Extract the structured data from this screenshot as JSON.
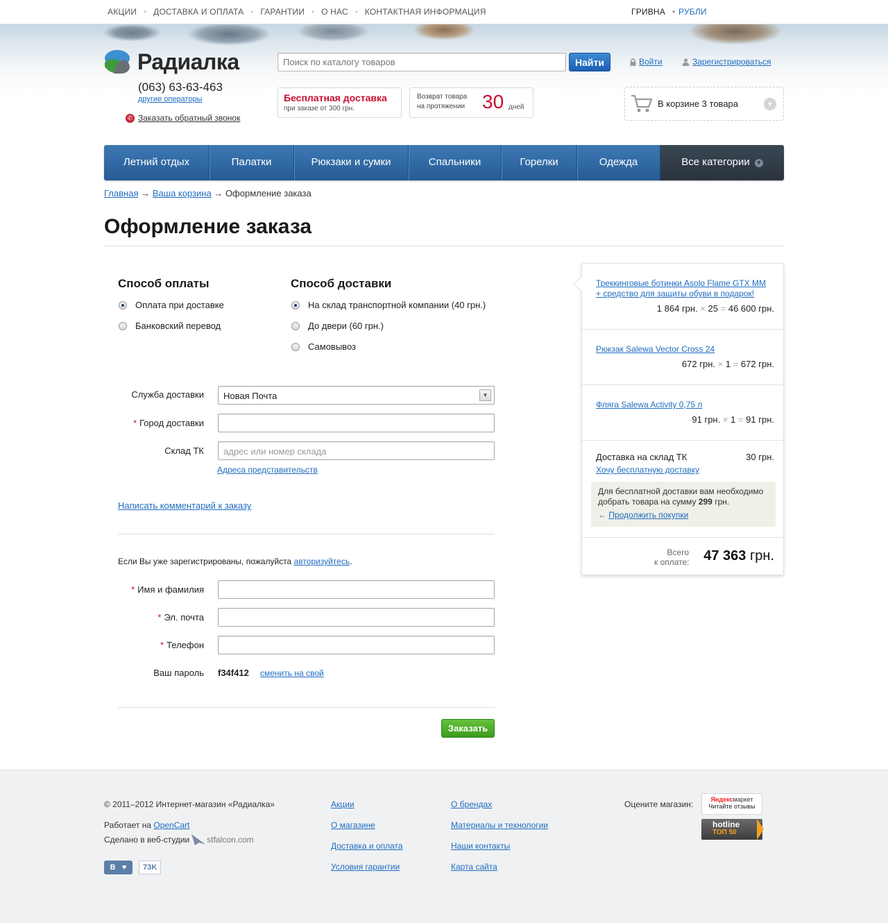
{
  "topnav": {
    "items": [
      "АКЦИИ",
      "ДОСТАВКА И ОПЛАТА",
      "ГАРАНТИИ",
      "О НАС",
      "КОНТАКТНАЯ ИНФОРМАЦИЯ"
    ],
    "currency_active": "ГРИВНА",
    "currency_other": "РУБЛИ"
  },
  "header": {
    "logo": "Радиалка",
    "phone": "(063) 63-63-463",
    "other_operators": "другие операторы",
    "callback": "Заказать обратный звонок",
    "search_placeholder": "Поиск по каталогу товаров",
    "search_button": "Найти",
    "login": "Войти",
    "register": "Зарегистрироваться",
    "promo_delivery_title": "Бесплатная доставка",
    "promo_delivery_sub": "при заказе от 300 грн.",
    "promo_return_line1": "Возврат товара",
    "promo_return_line2": "на протяжении",
    "promo_return_days": "30",
    "promo_return_unit": "дней",
    "cart_text": "В корзине 3 товара"
  },
  "mainnav": {
    "items": [
      "Летний отдых",
      "Палатки",
      "Рюкзаки и сумки",
      "Спальники",
      "Горелки",
      "Одежда"
    ],
    "all": "Все категории"
  },
  "breadcrumbs": {
    "home": "Главная",
    "cart": "Ваша корзина",
    "current": "Оформление заказа",
    "arrow": "→"
  },
  "page_title": "Оформление заказа",
  "payment": {
    "title": "Способ оплаты",
    "options": [
      "Оплата при доставке",
      "Банковский перевод"
    ],
    "selected": 0
  },
  "delivery": {
    "title": "Способ доставки",
    "options": [
      "На склад транспортной компании (40 грн.)",
      "До двери (60 грн.)",
      "Самовывоз"
    ],
    "selected": 0
  },
  "shipping_form": {
    "service_label": "Служба доставки",
    "service_value": "Новая Почта",
    "city_label": "Город доставки",
    "city_value": "",
    "warehouse_label": "Склад ТК",
    "warehouse_placeholder": "адрес или номер склада",
    "offices_link": "Адреса представительств",
    "comment_link": "Написать комментарий к заказу"
  },
  "auth_note": {
    "before": "Если Вы уже зарегистрированы, пожалуйста ",
    "link": "авторизуйтесь",
    "after": "."
  },
  "contact_form": {
    "name_label": "Имя и фамилия",
    "email_label": "Эл. почта",
    "phone_label": "Телефон",
    "password_label": "Ваш пароль",
    "password_value": "f34f412",
    "password_change": "сменить на свой",
    "submit": "Заказать"
  },
  "summary": {
    "items": [
      {
        "name": "Треккинговые ботинки Asolo Flame GTX MM + средство для защиты обуви в подарок!",
        "price": "1 864 грн.",
        "qty": "25",
        "total": "46 600 грн."
      },
      {
        "name": "Рюкзак Salewa Vector Cross 24",
        "price": "672 грн.",
        "qty": "1",
        "total": "672 грн."
      },
      {
        "name": "Фляга Salewa Activity 0,75 л",
        "price": "91 грн.",
        "qty": "1",
        "total": "91 грн."
      }
    ],
    "times": "×",
    "equals": "=",
    "delivery_label": "Доставка на склад ТК",
    "delivery_value": "30 грн.",
    "free_link": "Хочу бесплатную доставку",
    "note_before": "Для бесплатной доставки вам необходимо добрать товара на сумму ",
    "note_amount": "299",
    "note_after": " грн.",
    "continue": "Продолжить покупки",
    "total_label1": "Всего",
    "total_label2": "к оплате:",
    "total_number": "47 363",
    "total_unit": "грн."
  },
  "footer": {
    "copyright": "© 2011–2012 Интернет-магазин «Радиалка»",
    "powered": "Работает на",
    "opencart": "OpenCart",
    "made": "Сделано в веб-студии",
    "studio": "stfalcon.com",
    "vk_count": "73K",
    "col1": [
      "Акции",
      "О магазине",
      "Доставка и оплата",
      "Условия гарантии"
    ],
    "col2": [
      "О брендах",
      "Материалы и технологии",
      "Наши контакты",
      "Карта сайта"
    ],
    "rate": "Оцените магазин:",
    "ym_brand1": "Яндекс",
    "ym_brand2": "маркет",
    "ym_sub": "Читайте отзывы",
    "hotline": "hotline",
    "hotline_sub": "ТОП 50"
  },
  "colors": {
    "accent_blue": "#1f6cc0",
    "nav_blue": "#2f6aa5",
    "promo_red": "#c8102e",
    "order_green": "#4aaa27"
  }
}
